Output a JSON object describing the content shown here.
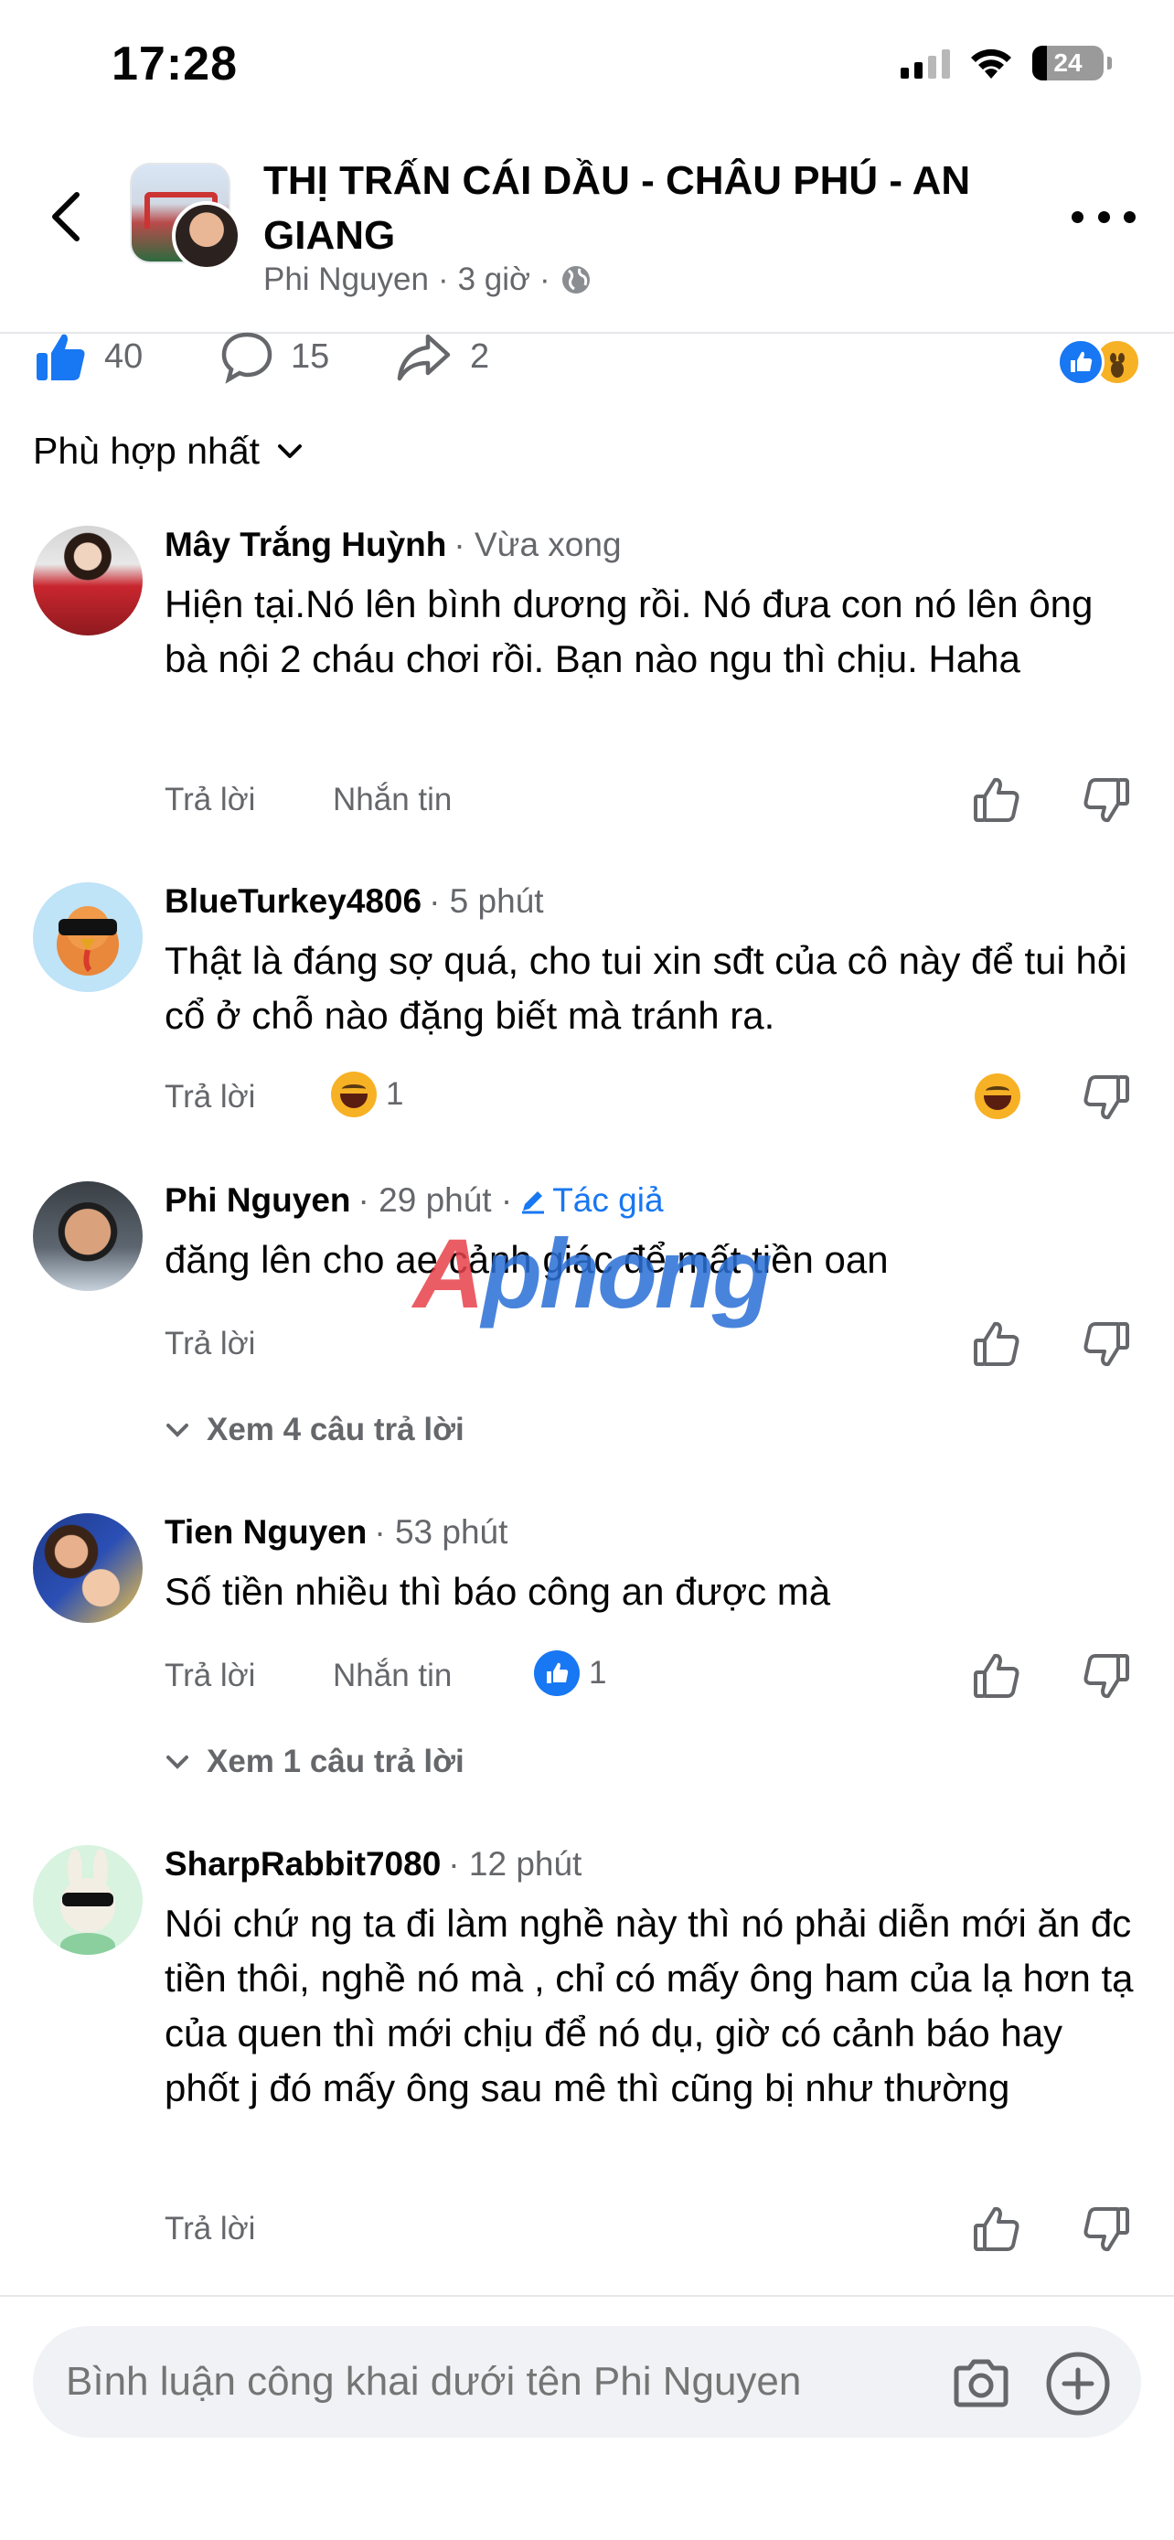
{
  "status_bar": {
    "time": "17:28",
    "battery": "24"
  },
  "header": {
    "title": "THỊ TRẤN CÁI DẦU - CHÂU PHÚ - AN GIANG",
    "author": "Phi Nguyen",
    "time": "3 giờ",
    "separator": "·"
  },
  "stats": {
    "likes": "40",
    "comments": "15",
    "shares": "2"
  },
  "sort": {
    "label": "Phù hợp nhất"
  },
  "comments": [
    {
      "name": "Mây Trắng Huỳnh",
      "time": "· Vừa xong",
      "text": "Hiện tại.Nó lên bình dương rồi. Nó đưa con nó lên ông bà nội 2 cháu chơi rồi. Bạn nào ngu thì chịu. Haha",
      "reply": "Trả lời",
      "message": "Nhắn tin"
    },
    {
      "name": "BlueTurkey4806",
      "time": "· 5 phút",
      "text": "Thật là đáng sợ quá, cho tui xin sđt của cô này để tui hỏi cổ ở chỗ nào đặng biết mà tránh ra.",
      "reply": "Trả lời",
      "reaction_count": "1"
    },
    {
      "name": "Phi Nguyen",
      "time": "· 29 phút ·",
      "author_badge": "Tác giả",
      "text": "đăng lên cho ae cảnh giác để mất tiền oan",
      "reply": "Trả lời",
      "view_replies": "Xem 4 câu trả lời"
    },
    {
      "name": "Tien Nguyen",
      "time": "· 53 phút",
      "text": "Số tiền nhiều thì báo công an được  mà",
      "reply": "Trả lời",
      "message": "Nhắn tin",
      "reaction_count": "1",
      "view_replies": "Xem 1 câu trả lời"
    },
    {
      "name": "SharpRabbit7080",
      "time": "· 12 phút",
      "text": "Nói chứ ng ta đi làm nghề này thì nó phải diễn mới ăn đc tiền thôi, nghề nó mà , chỉ có mấy ông ham của lạ hơn tạ của quen thì mới chịu để nó dụ, giờ có cảnh báo hay phốt j đó mấy ông sau mê thì cũng bị như thường",
      "reply": "Trả lời"
    }
  ],
  "watermark": {
    "part1": "A",
    "part2": "phong"
  },
  "composer": {
    "placeholder": "Bình luận công khai dưới tên Phi Nguyen"
  },
  "colors": {
    "accent": "#1877f2",
    "muted": "#65676b",
    "text": "#050505"
  }
}
